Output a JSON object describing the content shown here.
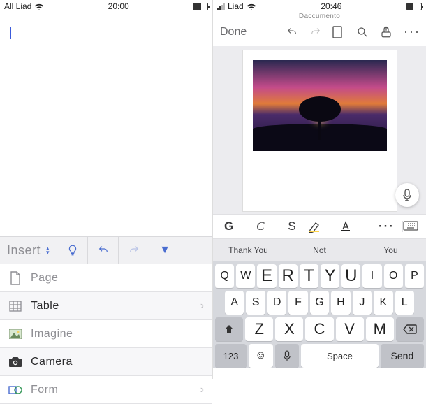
{
  "left": {
    "status": {
      "carrier": "All Liad",
      "time": "20:00"
    },
    "insert": {
      "label": "Insert",
      "items": [
        {
          "icon": "page",
          "label": "Page"
        },
        {
          "icon": "table",
          "label": "Table"
        },
        {
          "icon": "image",
          "label": "Imagine"
        },
        {
          "icon": "camera",
          "label": "Camera"
        },
        {
          "icon": "shapes",
          "label": "Form"
        }
      ]
    }
  },
  "right": {
    "status": {
      "carrier": "Liad",
      "time": "20:46"
    },
    "doc_title": "Daccumento",
    "done": "Done",
    "format": {
      "bold": "G",
      "italic": "C",
      "strike": "S"
    },
    "suggestions": [
      "Thank You",
      "Not",
      "You"
    ],
    "keyboard": {
      "row1": [
        "Q",
        "W",
        "E",
        "R",
        "T",
        "Y",
        "U",
        "I",
        "O",
        "P"
      ],
      "row2": [
        "A",
        "S",
        "D",
        "F",
        "G",
        "H",
        "J",
        "K",
        "L"
      ],
      "row3": [
        "Z",
        "X",
        "C",
        "V",
        "M"
      ],
      "numKey": "123",
      "space": "Space",
      "send": "Send"
    }
  }
}
